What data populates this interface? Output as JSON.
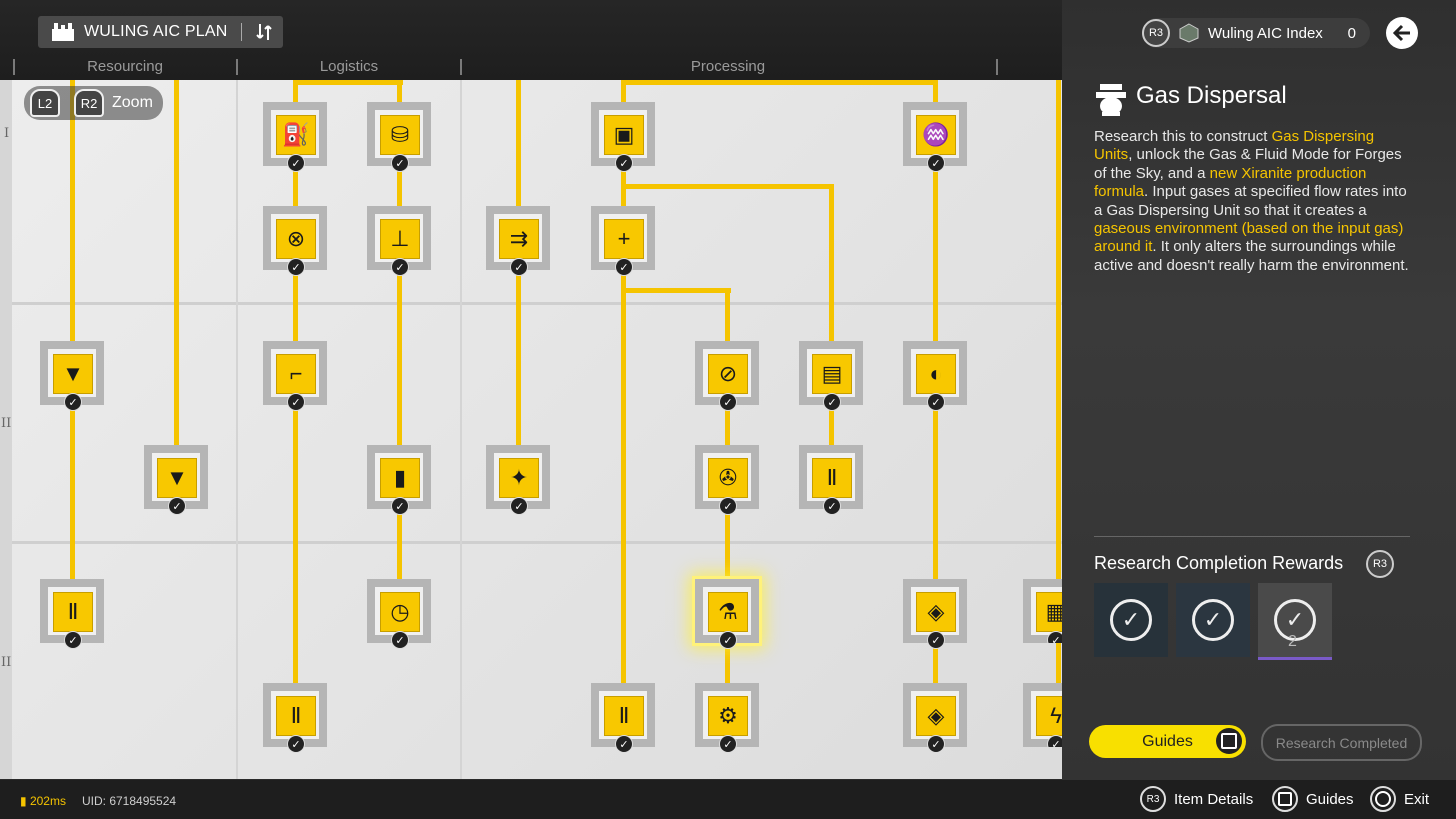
{
  "header": {
    "title": "WULING AIC PLAN",
    "plan_icon": "factory-icon",
    "swap_icon": "swap-icon",
    "categories": [
      "Resourcing",
      "Logistics",
      "Processing"
    ]
  },
  "tiers": [
    "I",
    "II",
    "III"
  ],
  "zoom": {
    "l2": "L2",
    "r2": "R2",
    "label": "Zoom"
  },
  "index": {
    "button": "R3",
    "label": "Wuling AIC Index",
    "value": "0"
  },
  "panel": {
    "title": "Gas Dispersal",
    "desc_1": "Research this to construct ",
    "desc_hl1": "Gas Dispersing Units",
    "desc_2": ", unlock the Gas & Fluid Mode for Forges of the Sky, and a ",
    "desc_hl2": "new Xiranite production formula",
    "desc_3": ". Input gases at specified flow rates into a Gas Dispersing Unit so that it creates a ",
    "desc_hl3": "gaseous environment (based on the input gas) around it",
    "desc_4": ". It only alters the surroundings while active and doesn't really harm the environment."
  },
  "rewards": {
    "title": "Research Completion Rewards",
    "button": "R3",
    "items": [
      {
        "count": ""
      },
      {
        "count": ""
      },
      {
        "count": "2"
      }
    ]
  },
  "buttons": {
    "guides": "Guides",
    "completed": "Research Completed"
  },
  "footer": {
    "ping": "202ms",
    "uid": "UID: 6718495524",
    "hints": [
      {
        "key": "R3",
        "label": "Item Details"
      },
      {
        "key": "square",
        "label": "Guides"
      },
      {
        "key": "circle",
        "label": "Exit"
      }
    ]
  },
  "tree_status": {
    "check": "✓"
  }
}
